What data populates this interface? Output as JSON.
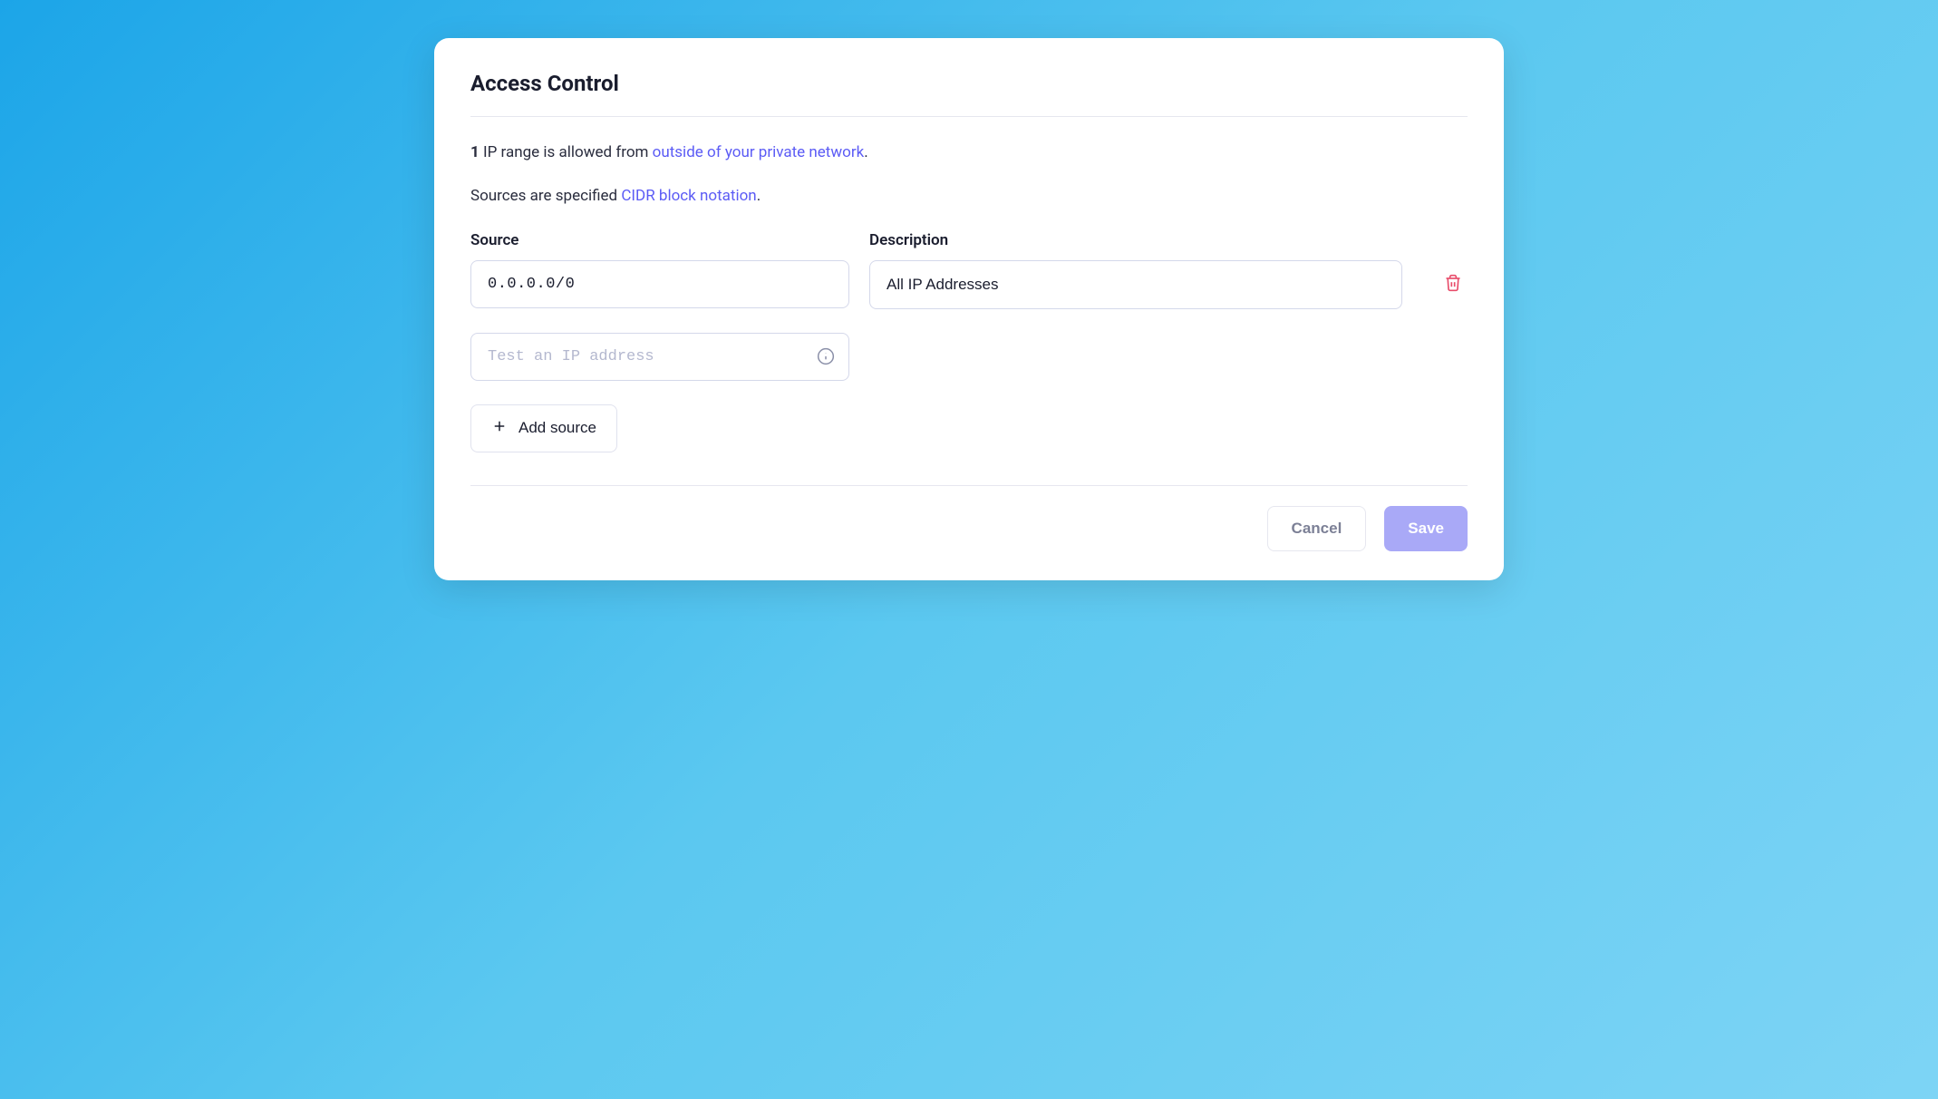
{
  "title": "Access Control",
  "info": {
    "count": "1",
    "line1_prefix": " IP range is allowed from ",
    "line1_link": "outside of your private network",
    "line1_suffix": ".",
    "line2_prefix": "Sources are specified ",
    "line2_link": "CIDR block notation",
    "line2_suffix": "."
  },
  "columns": {
    "source": "Source",
    "description": "Description"
  },
  "rows": [
    {
      "source": "0.0.0.0/0",
      "description": "All IP Addresses"
    }
  ],
  "test": {
    "placeholder": "Test an IP address"
  },
  "actions": {
    "add_source": "Add source",
    "cancel": "Cancel",
    "save": "Save"
  }
}
